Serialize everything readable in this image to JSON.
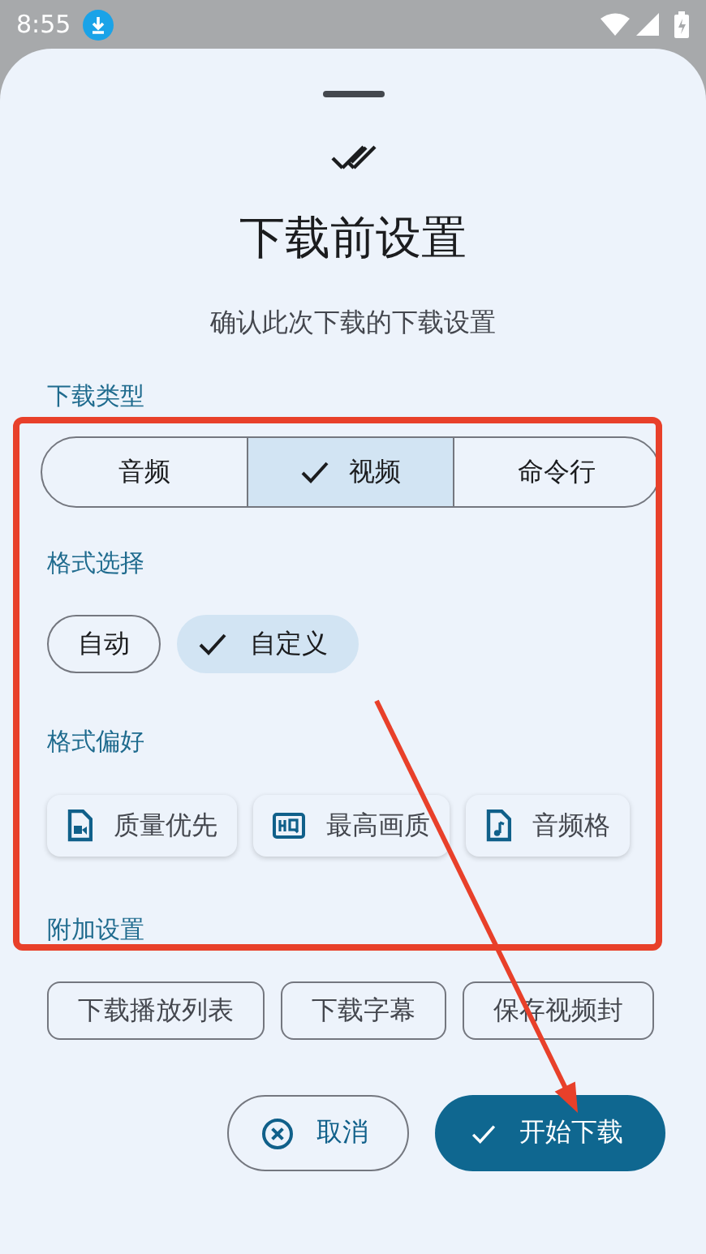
{
  "status_bar": {
    "time": "8:55"
  },
  "sheet": {
    "title": "下载前设置",
    "subtitle": "确认此次下载的下载设置",
    "sections": [
      {
        "label": "下载类型",
        "kind": "segmented",
        "options": [
          {
            "label": "音频",
            "selected": false
          },
          {
            "label": "视频",
            "selected": true
          },
          {
            "label": "命令行",
            "selected": false
          }
        ]
      },
      {
        "label": "格式选择",
        "kind": "choice",
        "options": [
          {
            "label": "自动",
            "selected": false
          },
          {
            "label": "自定义",
            "selected": true
          }
        ]
      },
      {
        "label": "格式偏好",
        "kind": "assist",
        "options": [
          {
            "label": "质量优先"
          },
          {
            "label": "最高画质"
          },
          {
            "label": "音频格"
          }
        ]
      },
      {
        "label": "附加设置",
        "kind": "filter",
        "options": [
          {
            "label": "下载播放列表",
            "selected": false
          },
          {
            "label": "下载字幕",
            "selected": false
          },
          {
            "label": "保存视频封",
            "selected": false
          }
        ]
      }
    ],
    "actions": [
      {
        "label": "取消",
        "kind": "outlined"
      },
      {
        "label": "开始下载",
        "kind": "filled"
      }
    ]
  }
}
